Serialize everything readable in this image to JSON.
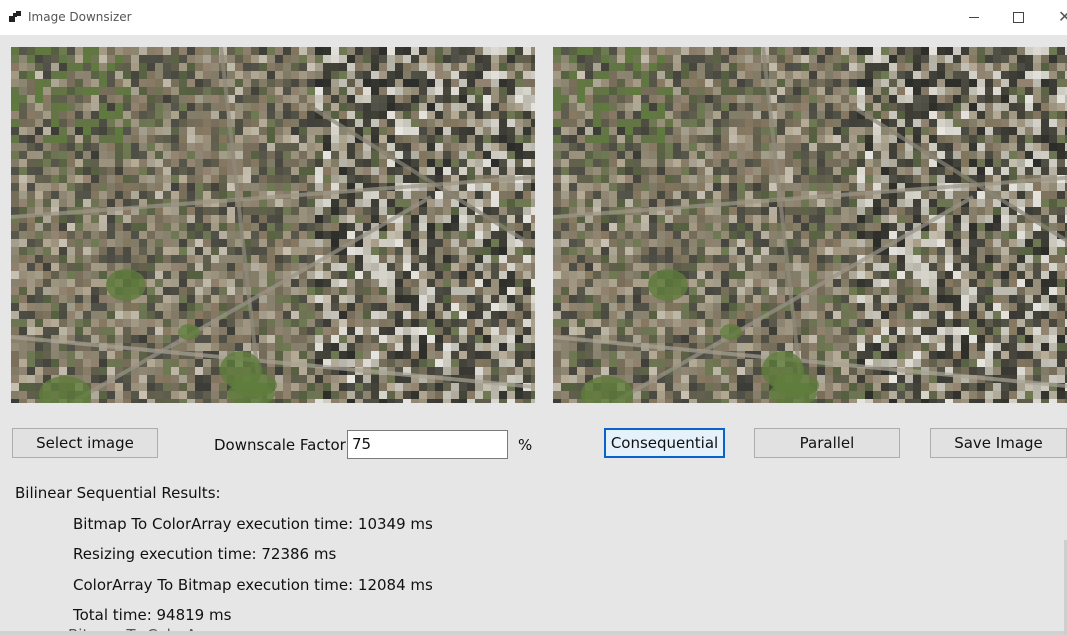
{
  "window": {
    "title": "Image Downsizer",
    "controls": {
      "minimize": "–",
      "maximize": "☐",
      "close": "✕"
    }
  },
  "images": {
    "original": {
      "description_icon": "aerial-city-image"
    },
    "resized": {
      "description_icon": "aerial-city-image"
    }
  },
  "controls": {
    "select_image_label": "Select image",
    "downscale_label": "Downscale Factor",
    "downscale_value": "75",
    "percent_label": "%",
    "consequential_label": "Consequential",
    "parallel_label": "Parallel",
    "save_image_label": "Save Image"
  },
  "results": {
    "heading": "Bilinear Sequential Results:",
    "lines": [
      "Bitmap To ColorArray execution time: 10349 ms",
      "Resizing execution time: 72386 ms",
      "ColorArray To Bitmap execution time: 12084 ms",
      "Total time: 94819 ms"
    ],
    "cutoff_line": "Bitmap To ColorArray:"
  },
  "colors": {
    "focus_accent": "#0a64c8",
    "form_background": "#e6e6e6"
  }
}
